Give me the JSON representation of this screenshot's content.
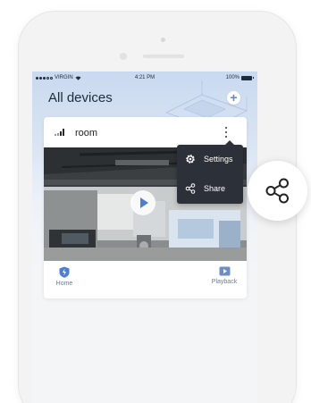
{
  "status_bar": {
    "carrier": "VIRGIN",
    "time": "4:21 PM",
    "battery": "100%"
  },
  "header": {
    "title": "All devices",
    "add_icon": "plus-circle-icon"
  },
  "device_card": {
    "name": "room",
    "signal_icon": "signal-bars-icon",
    "more_icon": "more-vertical-icon",
    "play_icon": "play-icon"
  },
  "context_menu": {
    "items": [
      {
        "label": "Settings",
        "icon": "gear-icon"
      },
      {
        "label": "Share",
        "icon": "share-icon"
      }
    ]
  },
  "bottom_nav": {
    "home": {
      "label": "Home",
      "icon": "home-shield-icon"
    },
    "playback": {
      "label": "Playback",
      "icon": "playback-icon"
    }
  },
  "callout": {
    "icon": "share-icon"
  },
  "colors": {
    "accent": "#4a7fd3",
    "menu_bg": "#2c3038",
    "title_text": "#1d2b3a"
  }
}
